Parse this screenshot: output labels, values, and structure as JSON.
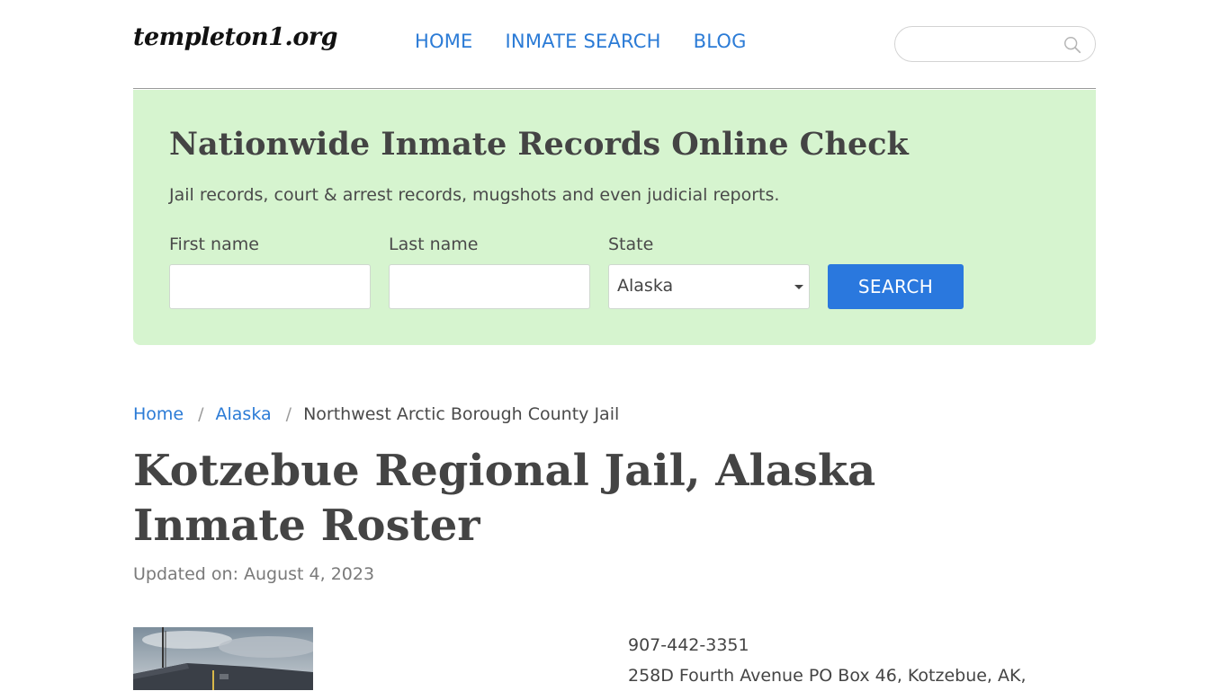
{
  "header": {
    "logo_text": "templeton1.org",
    "nav": [
      {
        "label": "HOME"
      },
      {
        "label": "INMATE SEARCH"
      },
      {
        "label": "BLOG"
      }
    ],
    "search_placeholder": "",
    "search_icon": "search-icon"
  },
  "hero": {
    "title": "Nationwide Inmate Records Online Check",
    "subtitle": "Jail records, court & arrest records, mugshots and even judicial reports.",
    "first_name_label": "First name",
    "first_name_value": "",
    "last_name_label": "Last name",
    "last_name_value": "",
    "state_label": "State",
    "state_value": "Alaska",
    "search_button": "SEARCH"
  },
  "breadcrumb": {
    "items": [
      "Home",
      "Alaska"
    ],
    "separator": "/",
    "current": "Northwest Arctic Borough County Jail"
  },
  "page": {
    "title": "Kotzebue Regional Jail, Alaska Inmate Roster",
    "updated": "Updated on: August 4, 2023"
  },
  "contact": {
    "phone": "907-442-3351",
    "address": "258D Fourth Avenue PO Box 46, Kotzebue, AK,"
  },
  "colors": {
    "link": "#2b7bd6",
    "hero_bg": "#d6f4cf",
    "button": "#2a78de"
  }
}
